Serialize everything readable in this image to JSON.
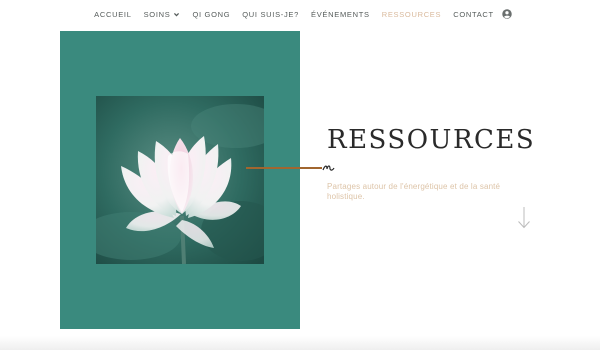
{
  "nav": {
    "items": [
      {
        "label": "ACCUEIL"
      },
      {
        "label": "SOINS"
      },
      {
        "label": "QI GONG"
      },
      {
        "label": "QUI SUIS-JE?"
      },
      {
        "label": "ÉVÉNEMENTS"
      },
      {
        "label": "RESSOURCES"
      },
      {
        "label": "CONTACT"
      }
    ],
    "active_label": "RESSOURCES",
    "dropdown_icon": "chevron-down-icon",
    "account_icon": "user-circle-icon"
  },
  "hero": {
    "title": "RESSOURCES",
    "subtitle": "Partages autour de l'énergétique et de la santé holistique.",
    "image": "lotus-flower-photo",
    "scroll_icon": "arrow-down-icon"
  },
  "colors": {
    "panel": "#3a8a7e",
    "accent_line": "#a1662f",
    "nav_active": "#d9b99c",
    "subtitle": "#ddc4a8",
    "title": "#2a2a2a"
  }
}
